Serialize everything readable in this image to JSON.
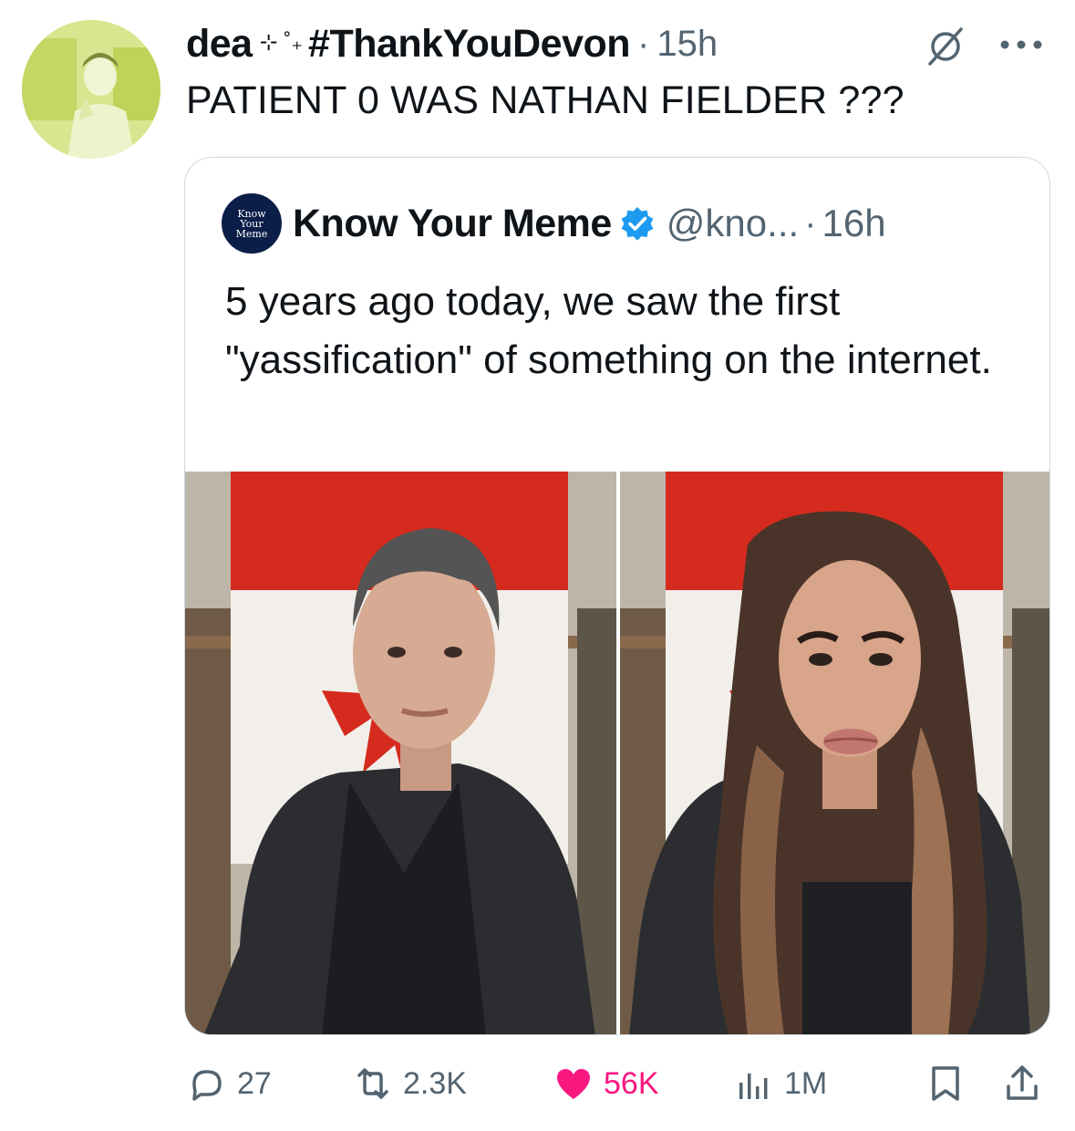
{
  "tweet": {
    "display_name": "dea",
    "name_decoration": "⊹ ˚₊",
    "hashtag": "#ThankYouDevon",
    "separator": "·",
    "time": "15h",
    "text": "PATIENT 0 WAS NATHAN FIELDER ???"
  },
  "quote": {
    "avatar_lines": [
      "Know",
      "Your",
      "Meme"
    ],
    "name": "Know Your Meme",
    "handle": "@kno...",
    "separator": "·",
    "time": "16h",
    "text": "5 years ago today, we saw the first \"yassification\" of something on the internet."
  },
  "actions": {
    "replies": "27",
    "reposts": "2.3K",
    "likes": "56K",
    "views": "1M"
  },
  "colors": {
    "like_pink": "#f91880",
    "verified_blue": "#1d9bf0",
    "secondary_text": "#536471",
    "flag_red": "#d52b1e"
  }
}
